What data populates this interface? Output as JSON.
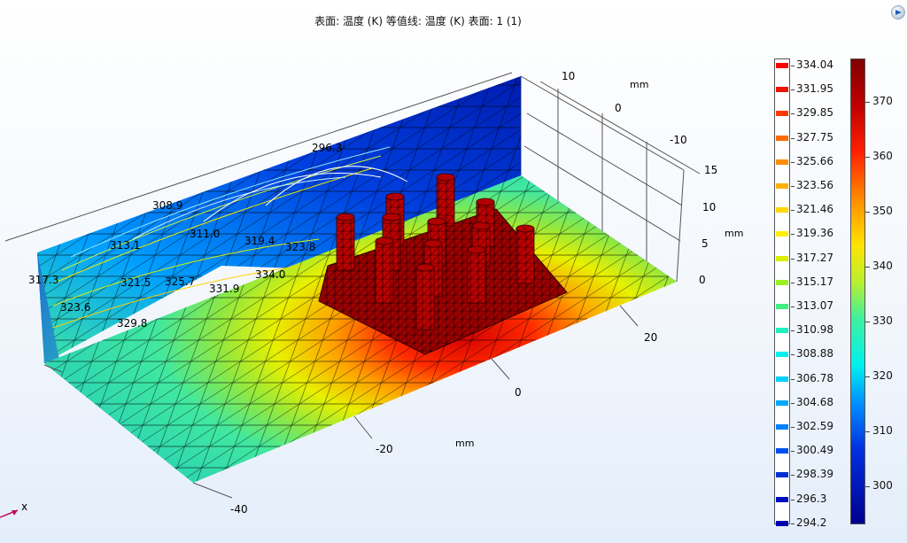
{
  "title": "表面: 温度 (K)  等值线: 温度 (K)  表面: 1 (1)",
  "icons": {
    "corner": "play-icon"
  },
  "axes": {
    "x_unit": "mm",
    "y_unit": "mm",
    "z_unit": "mm",
    "x_ticks": [
      "-40",
      "-20",
      "0",
      "20"
    ],
    "y_ticks": [
      "10",
      "0",
      "-10"
    ],
    "z_ticks": [
      "15",
      "10",
      "5",
      "0"
    ],
    "triad_label": "x"
  },
  "contour_labels": [
    "317.3",
    "323.6",
    "329.8",
    "321.5",
    "325.7",
    "331.9",
    "334.0",
    "308.9",
    "313.1",
    "311.0",
    "296.3",
    "319.4",
    "323.8"
  ],
  "legend_contour": {
    "values": [
      "334.04",
      "331.95",
      "329.85",
      "327.75",
      "325.66",
      "323.56",
      "321.46",
      "319.36",
      "317.27",
      "315.17",
      "313.07",
      "310.98",
      "308.88",
      "306.78",
      "304.68",
      "302.59",
      "300.49",
      "298.39",
      "296.3",
      "294.2"
    ],
    "colors": [
      "#ff0000",
      "#ee1400",
      "#ff3a00",
      "#ff6a00",
      "#ff8c00",
      "#ffb000",
      "#ffd800",
      "#ffee00",
      "#d8f000",
      "#9cf020",
      "#40f080",
      "#20f0c0",
      "#00f0f0",
      "#00d0ff",
      "#00a8ff",
      "#0080ff",
      "#0050f0",
      "#0030d0",
      "#0010c0",
      "#0000b0"
    ]
  },
  "legend_surface": {
    "values": [
      "370",
      "360",
      "350",
      "340",
      "330",
      "320",
      "310",
      "300"
    ]
  }
}
